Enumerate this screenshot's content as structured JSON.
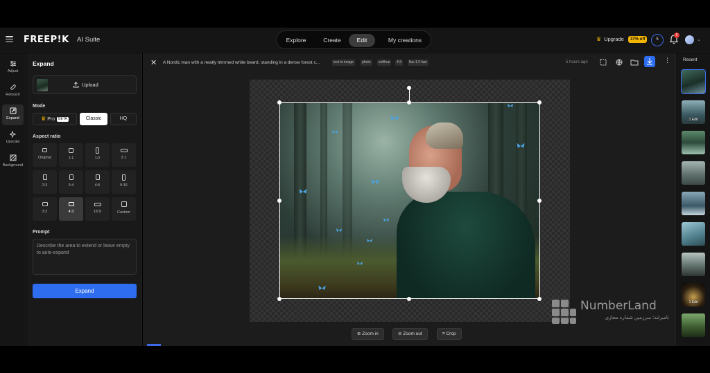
{
  "header": {
    "logo": "FREEP!K",
    "suite": "AI Suite",
    "nav": [
      {
        "label": "Explore",
        "active": false
      },
      {
        "label": "Create",
        "active": false
      },
      {
        "label": "Edit",
        "active": true
      },
      {
        "label": "My creations",
        "active": false
      }
    ],
    "upgrade_label": "Upgrade",
    "upgrade_badge": "37% off",
    "credits": "5",
    "notifications": "5"
  },
  "toolrail": [
    {
      "label": "Adjust",
      "icon": "sliders-icon",
      "active": false
    },
    {
      "label": "Retouch",
      "icon": "bandage-icon",
      "active": false
    },
    {
      "label": "Expand",
      "icon": "expand-icon",
      "active": true
    },
    {
      "label": "Upscale",
      "icon": "sparkle-icon",
      "active": false
    },
    {
      "label": "Background",
      "icon": "background-icon",
      "active": false
    }
  ],
  "panel": {
    "title": "Expand",
    "upload_label": "Upload",
    "mode_label": "Mode",
    "modes": [
      {
        "label": "Pro",
        "badge": "BETA",
        "active": false
      },
      {
        "label": "Classic",
        "active": true
      },
      {
        "label": "HQ",
        "active": false
      }
    ],
    "aspect_label": "Aspect ratio",
    "ratios": [
      {
        "label": "Original",
        "active": false
      },
      {
        "label": "1:1",
        "active": false
      },
      {
        "label": "1:2",
        "active": false
      },
      {
        "label": "2:1",
        "active": false
      },
      {
        "label": "2:3",
        "active": false
      },
      {
        "label": "3:4",
        "active": false
      },
      {
        "label": "4:5",
        "active": false
      },
      {
        "label": "9:16",
        "active": false
      },
      {
        "label": "3:2",
        "active": false
      },
      {
        "label": "4:3",
        "active": true
      },
      {
        "label": "16:9",
        "active": false
      },
      {
        "label": "Custom",
        "active": false
      }
    ],
    "prompt_label": "Prompt",
    "prompt_placeholder": "Describe the area to extend or leave empty to auto-expand",
    "expand_button": "Expand"
  },
  "main": {
    "title": "A Nordic man with a neatly trimmed white beard, standing in a dense forest c...",
    "tags": [
      "text to image",
      "photo",
      "softhue",
      "4:3",
      "flux 1.0 fast"
    ],
    "time_ago": "5 hours ago",
    "zoom_in": "Zoom in",
    "zoom_out": "Zoom out",
    "crop": "Crop"
  },
  "recent": {
    "title": "Recent",
    "items": [
      {
        "edit": "",
        "active": true
      },
      {
        "edit": "1 Edit",
        "active": false
      },
      {
        "edit": "",
        "active": false
      },
      {
        "edit": "",
        "active": false
      },
      {
        "edit": "",
        "active": false
      },
      {
        "edit": "",
        "active": false
      },
      {
        "edit": "",
        "active": false
      },
      {
        "edit": "1 Edit",
        "active": false
      },
      {
        "edit": "",
        "active": false
      }
    ]
  },
  "watermark": {
    "title": "NumberLand",
    "subtitle": "نامبرلند؛ سرزمین شماره مجازی"
  },
  "colors": {
    "accent": "#2f6df0",
    "badge": "#f2b600"
  }
}
